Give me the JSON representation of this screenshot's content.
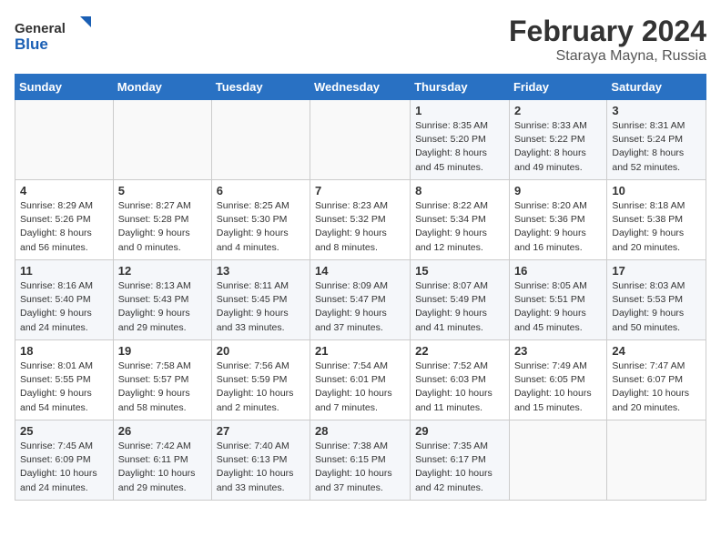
{
  "header": {
    "logo_general": "General",
    "logo_blue": "Blue",
    "month_year": "February 2024",
    "location": "Staraya Mayna, Russia"
  },
  "days_of_week": [
    "Sunday",
    "Monday",
    "Tuesday",
    "Wednesday",
    "Thursday",
    "Friday",
    "Saturday"
  ],
  "weeks": [
    [
      {
        "day": "",
        "info": ""
      },
      {
        "day": "",
        "info": ""
      },
      {
        "day": "",
        "info": ""
      },
      {
        "day": "",
        "info": ""
      },
      {
        "day": "1",
        "info": "Sunrise: 8:35 AM\nSunset: 5:20 PM\nDaylight: 8 hours\nand 45 minutes."
      },
      {
        "day": "2",
        "info": "Sunrise: 8:33 AM\nSunset: 5:22 PM\nDaylight: 8 hours\nand 49 minutes."
      },
      {
        "day": "3",
        "info": "Sunrise: 8:31 AM\nSunset: 5:24 PM\nDaylight: 8 hours\nand 52 minutes."
      }
    ],
    [
      {
        "day": "4",
        "info": "Sunrise: 8:29 AM\nSunset: 5:26 PM\nDaylight: 8 hours\nand 56 minutes."
      },
      {
        "day": "5",
        "info": "Sunrise: 8:27 AM\nSunset: 5:28 PM\nDaylight: 9 hours\nand 0 minutes."
      },
      {
        "day": "6",
        "info": "Sunrise: 8:25 AM\nSunset: 5:30 PM\nDaylight: 9 hours\nand 4 minutes."
      },
      {
        "day": "7",
        "info": "Sunrise: 8:23 AM\nSunset: 5:32 PM\nDaylight: 9 hours\nand 8 minutes."
      },
      {
        "day": "8",
        "info": "Sunrise: 8:22 AM\nSunset: 5:34 PM\nDaylight: 9 hours\nand 12 minutes."
      },
      {
        "day": "9",
        "info": "Sunrise: 8:20 AM\nSunset: 5:36 PM\nDaylight: 9 hours\nand 16 minutes."
      },
      {
        "day": "10",
        "info": "Sunrise: 8:18 AM\nSunset: 5:38 PM\nDaylight: 9 hours\nand 20 minutes."
      }
    ],
    [
      {
        "day": "11",
        "info": "Sunrise: 8:16 AM\nSunset: 5:40 PM\nDaylight: 9 hours\nand 24 minutes."
      },
      {
        "day": "12",
        "info": "Sunrise: 8:13 AM\nSunset: 5:43 PM\nDaylight: 9 hours\nand 29 minutes."
      },
      {
        "day": "13",
        "info": "Sunrise: 8:11 AM\nSunset: 5:45 PM\nDaylight: 9 hours\nand 33 minutes."
      },
      {
        "day": "14",
        "info": "Sunrise: 8:09 AM\nSunset: 5:47 PM\nDaylight: 9 hours\nand 37 minutes."
      },
      {
        "day": "15",
        "info": "Sunrise: 8:07 AM\nSunset: 5:49 PM\nDaylight: 9 hours\nand 41 minutes."
      },
      {
        "day": "16",
        "info": "Sunrise: 8:05 AM\nSunset: 5:51 PM\nDaylight: 9 hours\nand 45 minutes."
      },
      {
        "day": "17",
        "info": "Sunrise: 8:03 AM\nSunset: 5:53 PM\nDaylight: 9 hours\nand 50 minutes."
      }
    ],
    [
      {
        "day": "18",
        "info": "Sunrise: 8:01 AM\nSunset: 5:55 PM\nDaylight: 9 hours\nand 54 minutes."
      },
      {
        "day": "19",
        "info": "Sunrise: 7:58 AM\nSunset: 5:57 PM\nDaylight: 9 hours\nand 58 minutes."
      },
      {
        "day": "20",
        "info": "Sunrise: 7:56 AM\nSunset: 5:59 PM\nDaylight: 10 hours\nand 2 minutes."
      },
      {
        "day": "21",
        "info": "Sunrise: 7:54 AM\nSunset: 6:01 PM\nDaylight: 10 hours\nand 7 minutes."
      },
      {
        "day": "22",
        "info": "Sunrise: 7:52 AM\nSunset: 6:03 PM\nDaylight: 10 hours\nand 11 minutes."
      },
      {
        "day": "23",
        "info": "Sunrise: 7:49 AM\nSunset: 6:05 PM\nDaylight: 10 hours\nand 15 minutes."
      },
      {
        "day": "24",
        "info": "Sunrise: 7:47 AM\nSunset: 6:07 PM\nDaylight: 10 hours\nand 20 minutes."
      }
    ],
    [
      {
        "day": "25",
        "info": "Sunrise: 7:45 AM\nSunset: 6:09 PM\nDaylight: 10 hours\nand 24 minutes."
      },
      {
        "day": "26",
        "info": "Sunrise: 7:42 AM\nSunset: 6:11 PM\nDaylight: 10 hours\nand 29 minutes."
      },
      {
        "day": "27",
        "info": "Sunrise: 7:40 AM\nSunset: 6:13 PM\nDaylight: 10 hours\nand 33 minutes."
      },
      {
        "day": "28",
        "info": "Sunrise: 7:38 AM\nSunset: 6:15 PM\nDaylight: 10 hours\nand 37 minutes."
      },
      {
        "day": "29",
        "info": "Sunrise: 7:35 AM\nSunset: 6:17 PM\nDaylight: 10 hours\nand 42 minutes."
      },
      {
        "day": "",
        "info": ""
      },
      {
        "day": "",
        "info": ""
      }
    ]
  ]
}
